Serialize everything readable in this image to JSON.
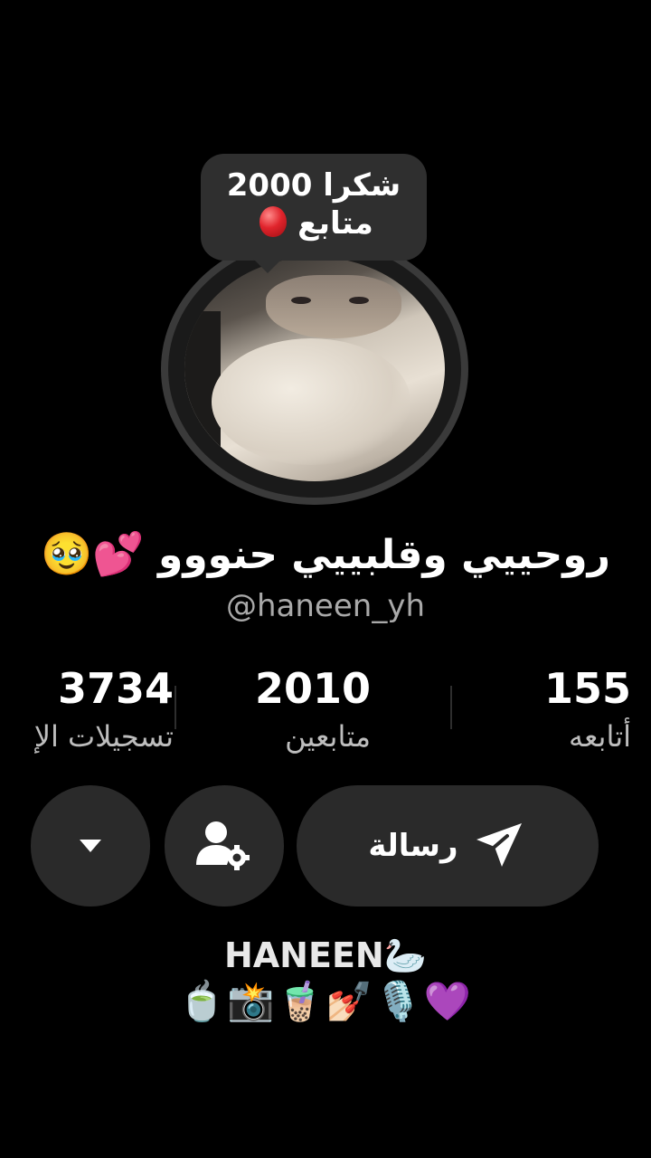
{
  "profile": {
    "milestone_line1": "شكرا 2000",
    "milestone_line2": "متابع",
    "display_name": "روحييي وقلبييي حنووو",
    "display_name_emojis": "🥹💕",
    "handle": "@haneen_yh"
  },
  "stats": {
    "following_count": "155",
    "following_label": "أتابعه",
    "followers_count": "2010",
    "followers_label": "متابعين",
    "likes_count": "3734",
    "likes_label": "تسجيلات الإ"
  },
  "actions": {
    "message_label": "رسالة"
  },
  "bio": {
    "title": "HANEEN🦢",
    "emojis": "🍵📸🧋💅🏻🎙️💜"
  },
  "colors": {
    "background": "#000000",
    "button_bg": "#2a2a2a",
    "handle_text": "#a9a9a9"
  },
  "icons": {
    "balloon": "balloon-icon",
    "send": "send-icon",
    "user_settings": "user-settings-icon",
    "dropdown": "caret-down-icon"
  }
}
